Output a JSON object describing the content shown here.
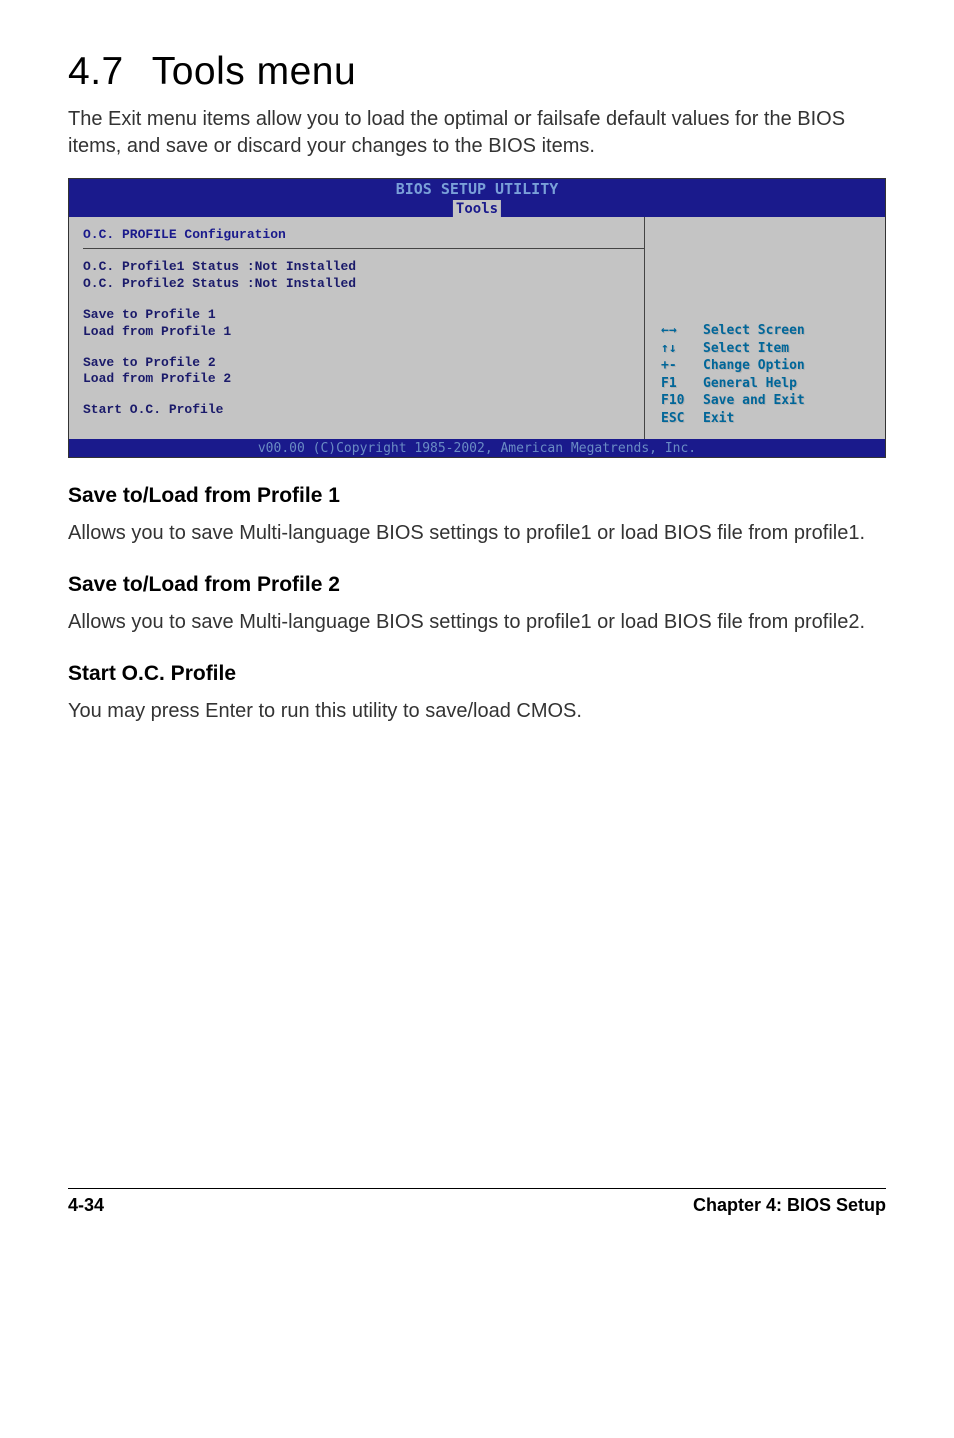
{
  "heading": {
    "num": "4.7",
    "title": "Tools menu"
  },
  "intro": "The Exit menu items allow you to load the optimal or failsafe default values for the BIOS items, and save or discard your changes to the BIOS items.",
  "bios": {
    "title_text": "BIOS SETUP UTILITY",
    "tab": "Tools",
    "section_title": "O.C. PROFILE Configuration",
    "status1": "O.C. Profile1 Status :Not Installed",
    "status2": "O.C. Profile2 Status :Not Installed",
    "save1": "Save to Profile 1",
    "load1": "Load from Profile 1",
    "save2": "Save to Profile 2",
    "load2": "Load from Profile 2",
    "start_oc": "Start O.C. Profile",
    "help": [
      {
        "key": "←→",
        "text": "Select Screen"
      },
      {
        "key": "↑↓",
        "text": "Select Item"
      },
      {
        "key": "+-",
        "text": "Change Option"
      },
      {
        "key": "F1",
        "text": "General Help"
      },
      {
        "key": "F10",
        "text": "Save and Exit"
      },
      {
        "key": "ESC",
        "text": "Exit"
      }
    ],
    "footer": "v00.00 (C)Copyright 1985-2002, American Megatrends, Inc."
  },
  "sections": {
    "h1": "Save to/Load from Profile 1",
    "p1": "Allows you to save Multi-language BIOS settings to profile1 or load BIOS file from profile1.",
    "h2": "Save to/Load from Profile 2",
    "p2": "Allows you to save Multi-language BIOS settings to profile1 or load BIOS file from profile2.",
    "h3": "Start O.C. Profile",
    "p3": "You may press Enter to run this utility to save/load CMOS."
  },
  "footer": {
    "left": "4-34",
    "right": "Chapter 4: BIOS Setup"
  }
}
